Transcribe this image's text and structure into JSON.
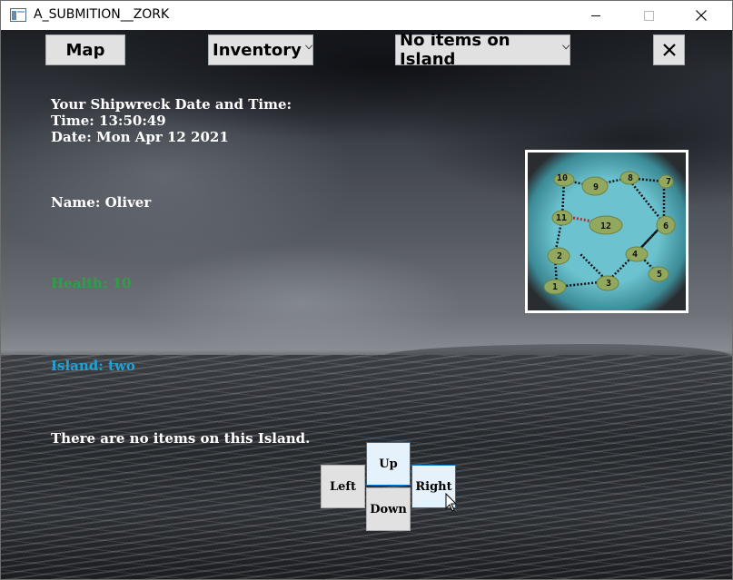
{
  "window": {
    "title": "A_SUBMITION__ZORK"
  },
  "toolbar": {
    "map_label": "Map",
    "inventory_label": "Inventory",
    "items_label": "No items on Island"
  },
  "info": {
    "shipwreck_heading": "Your Shipwreck Date and Time:",
    "time": "Time: 13:50:49",
    "date": "Date: Mon Apr 12 2021",
    "name": "Name: Oliver",
    "health": "Health: 10",
    "island": "Island: two",
    "items_message": "There are no items on this Island."
  },
  "colors": {
    "health": "#2ea043",
    "island": "#1ea3d8",
    "map_water": "#5bb7c7",
    "map_island": "#8fa65e"
  },
  "map": {
    "island_numbers": [
      "10",
      "9",
      "8",
      "7",
      "11",
      "12",
      "6",
      "2",
      "4",
      "5",
      "1",
      "3"
    ]
  },
  "navigation": {
    "up": "Up",
    "left": "Left",
    "right": "Right",
    "down": "Down"
  },
  "icons": {
    "app": "window-icon",
    "minimize": "minimize-icon",
    "maximize": "maximize-icon",
    "close": "close-icon",
    "dropdown": "chevron-down-icon",
    "cursor": "mouse-pointer-icon"
  }
}
